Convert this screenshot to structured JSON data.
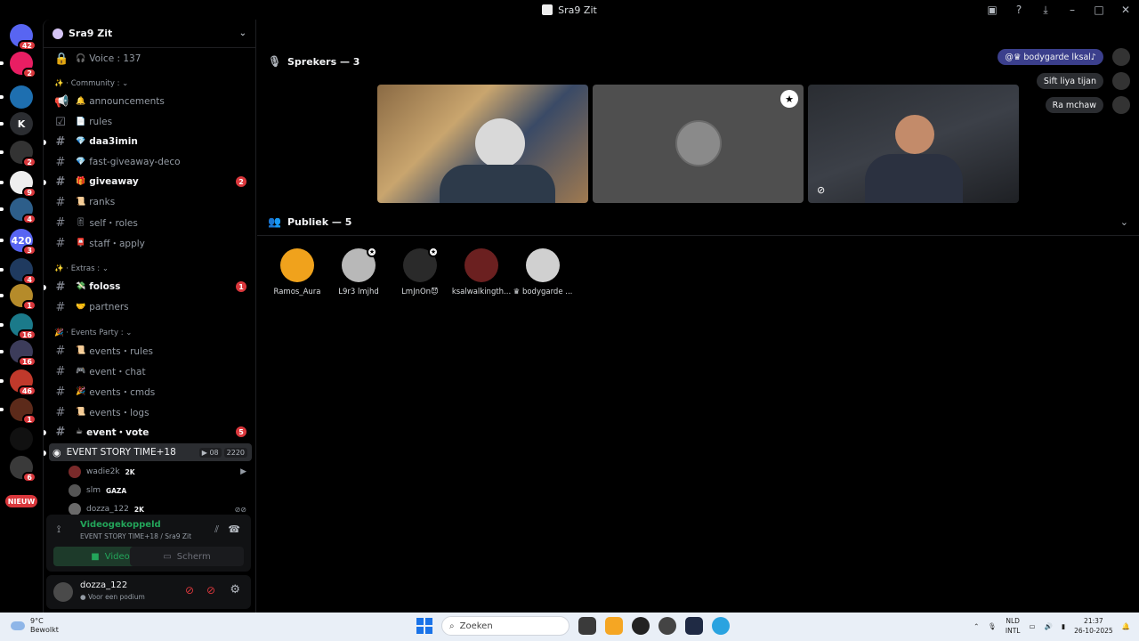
{
  "window": {
    "title": "Sra9 Zit",
    "controls": [
      "minimize",
      "maximize",
      "close"
    ]
  },
  "rail": {
    "servers": [
      {
        "label": "",
        "badge": "42",
        "color": "#5865f2"
      },
      {
        "label": "",
        "badge": "2",
        "color": "#e91e63"
      },
      {
        "label": "",
        "badge": "",
        "color": "#1e6fb0"
      },
      {
        "label": "K",
        "badge": "",
        "color": "#2b2d31"
      },
      {
        "label": "",
        "badge": "2",
        "color": "#333333"
      },
      {
        "label": "",
        "badge": "9",
        "color": "#eeeeee"
      },
      {
        "label": "",
        "badge": "4",
        "color": "#2d5e8a"
      },
      {
        "label": "420",
        "badge": "3",
        "color": "#5865f2"
      },
      {
        "label": "",
        "badge": "4",
        "color": "#1f3a5f"
      },
      {
        "label": "",
        "badge": "1",
        "color": "#b58b2a"
      },
      {
        "label": "",
        "badge": "16",
        "color": "#1b7a8a"
      },
      {
        "label": "",
        "badge": "16",
        "color": "#3c3c5a"
      },
      {
        "label": "",
        "badge": "46",
        "color": "#c0392b"
      },
      {
        "label": "",
        "badge": "1",
        "color": "#5c2a1a"
      },
      {
        "label": "",
        "badge": "",
        "color": "#111111"
      },
      {
        "label": "",
        "badge": "6",
        "color": "#3a3a3a"
      }
    ],
    "new_label": "NIEUW"
  },
  "guild": {
    "name": "Sra9 Zit",
    "voice_channel": "Voice : 137"
  },
  "categories": {
    "community": "Community :",
    "extras": "Extras :",
    "events": "Events Party :"
  },
  "channels": {
    "announcements": "announcements",
    "rules": "rules",
    "daa3imin": "daa3imin",
    "fast_giveaway": "fast-giveaway-deco",
    "giveaway": "giveaway",
    "giveaway_badge": "2",
    "ranks": "ranks",
    "self_roles": "self・roles",
    "staff_apply": "staff・apply",
    "foloss": "foloss",
    "foloss_badge": "1",
    "partners": "partners",
    "events_rules": "events・rules",
    "event_chat": "event・chat",
    "events_cmds": "events・cmds",
    "events_logs": "events・logs",
    "event_vote": "event・vote",
    "event_vote_badge": "5"
  },
  "stage_channel": {
    "name": "EVENT STORY TIME+18",
    "video_count": "08",
    "listeners": "2220",
    "users": [
      {
        "name": "wadie2k",
        "tag": "2K"
      },
      {
        "name": "slm",
        "tag": "GAZA"
      },
      {
        "name": "dozza_122",
        "tag": "2K"
      }
    ]
  },
  "voice_panel": {
    "status": "Videogekoppeld",
    "location": "EVENT STORY TIME+18 / Sra9 Zit",
    "video_label": "Video",
    "screen_label": "Scherm"
  },
  "user_panel": {
    "name": "dozza_122",
    "status": "Voor een podium"
  },
  "stage": {
    "speakers_label": "Sprekers — 3",
    "audience_label": "Publiek — 5",
    "audience": [
      {
        "name": "Ramos_Aura",
        "color": "#f0a21c",
        "mod": false
      },
      {
        "name": "L9r3 lmjhd",
        "color": "#b8b8b8",
        "mod": true
      },
      {
        "name": "LmJnOn😈",
        "color": "#2a2a2a",
        "mod": true
      },
      {
        "name": "ksalwalkingth...",
        "color": "#6b2020",
        "mod": false
      },
      {
        "name": "♛ bodygarde ...",
        "color": "#d0d0d0",
        "mod": false
      }
    ],
    "bubbles": [
      "@♛ bodygarde lksal♪",
      "Sift liya tijan",
      "Ra mchaw"
    ]
  },
  "taskbar": {
    "weather_temp": "9°C",
    "weather_desc": "Bewolkt",
    "search_placeholder": "Zoeken",
    "lang_top": "NLD",
    "lang_bottom": "INTL",
    "time": "21:37",
    "date": "26-10-2025"
  }
}
